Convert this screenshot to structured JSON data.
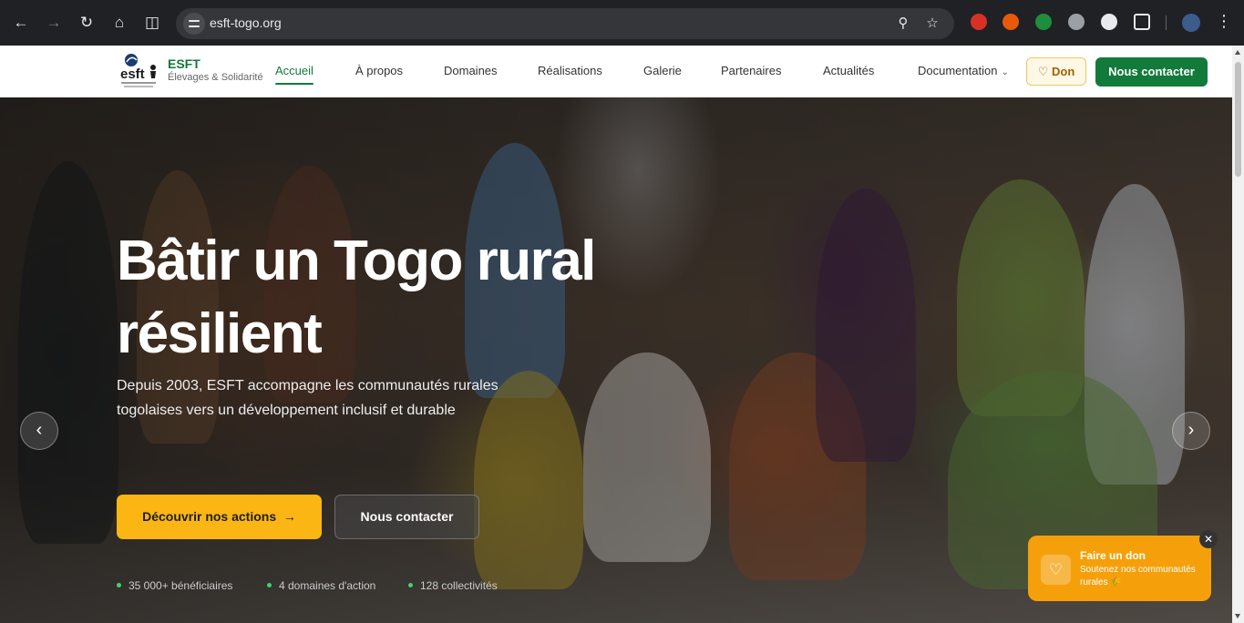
{
  "browser": {
    "url": "esft-togo.org",
    "icons": {
      "back": "arrow-left-icon",
      "forward": "arrow-right-icon",
      "reload": "reload-icon",
      "home": "home-icon",
      "split": "split-view-icon",
      "zoom": "zoom-icon",
      "bookmark": "star-icon",
      "menu": "more-vertical-icon"
    },
    "extensions": [
      "#d93025",
      "#e8590c",
      "#1e8e3e",
      "#9aa0a6",
      "#e8eaed",
      "#e8eaed"
    ]
  },
  "header": {
    "brand": "ESFT",
    "tagline": "Élevages & Solidarité",
    "logo_text": "esft",
    "nav": [
      {
        "label": "Accueil",
        "active": true
      },
      {
        "label": "À propos"
      },
      {
        "label": "Domaines"
      },
      {
        "label": "Réalisations"
      },
      {
        "label": "Galerie"
      },
      {
        "label": "Partenaires"
      },
      {
        "label": "Actualités"
      },
      {
        "label": "Documentation"
      }
    ],
    "don_label": "Don",
    "contact_label": "Nous contacter",
    "colors": {
      "primary": "#127a3a",
      "accent": "#fbb614"
    }
  },
  "hero": {
    "title_line1": "Bâtir un Togo rural",
    "title_line2": "résilient",
    "subtitle": "Depuis 2003, ESFT accompagne les communautés rurales togolaises vers un développement inclusif et durable",
    "primary_cta": "Découvrir nos actions",
    "secondary_cta": "Nous contacter",
    "stats": [
      "35 000+ bénéficiaires",
      "4 domaines d'action",
      "128 collectivités"
    ],
    "slides": {
      "count": 4,
      "active_index": 0
    }
  },
  "donate_popup": {
    "title": "Faire un don",
    "subtitle": "Soutenez nos communautés rurales 🌾"
  }
}
